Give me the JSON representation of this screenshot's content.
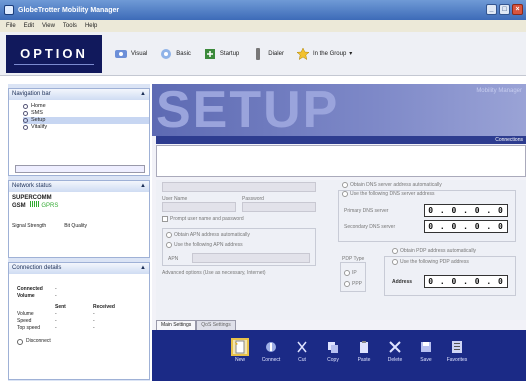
{
  "window": {
    "title": "GlobeTrotter Mobility Manager"
  },
  "menu": [
    "File",
    "Edit",
    "View",
    "Tools",
    "Help"
  ],
  "toolbar": {
    "logo": "OPTION",
    "items": [
      {
        "label": "Visual",
        "icon": "visual-icon"
      },
      {
        "label": "Basic",
        "icon": "basic-icon"
      },
      {
        "label": "Startup",
        "icon": "startup-icon"
      },
      {
        "label": "Dialer",
        "icon": "dialer-icon"
      },
      {
        "label": "In the Group",
        "icon": "star-icon"
      }
    ]
  },
  "nav_panel": {
    "title": "Navigation bar",
    "items": [
      "Home",
      "SMS",
      "Setup",
      "Vitalify"
    ],
    "selected": 2
  },
  "network_panel": {
    "title": "Network status",
    "carrier_line1": "SUPERCOMM",
    "carrier_line2": "GSM",
    "network_label": "GPRS",
    "sent_label": "Sent",
    "received_label": "Received",
    "speed_label": "Speed",
    "rows": [
      "Signal Strength",
      "Bit Quality"
    ]
  },
  "conn_panel": {
    "title": "Connection details",
    "connected_label": "Connected",
    "volume_label": "Volume",
    "col_sent": "Sent",
    "col_received": "Received",
    "row_labels": [
      "Volume",
      "Speed",
      "Top speed"
    ],
    "dash": "-",
    "disconnect_label": "Disconnect"
  },
  "setup": {
    "banner": "SETUP",
    "banner_sub": "Mobility Manager",
    "strip": "Connections",
    "username_label": "User Name",
    "password_label": "Password",
    "prompt_label": "Prompt user name and password",
    "apn_auto": "Obtain APN address automatically",
    "apn_manual": "Use the following APN address",
    "apn_label": "APN",
    "advanced_label": "Advanced options (Use as necessary, Internet)",
    "dns_auto": "Obtain DNS server address automatically",
    "dns_manual": "Use the following DNS server address",
    "primary_dns": "Primary DNS server",
    "secondary_dns": "Secondary DNS server",
    "pdp_type": "PDP Type",
    "pdp_ip": "IP",
    "pdp_ppp": "PPP",
    "pdp_auto": "Obtain PDP address automatically",
    "pdp_manual": "Use the following PDP address",
    "address_label": "Address",
    "ip_value": "0 . 0 . 0 . 0",
    "tabs": [
      "Main Settings",
      "QoS Settings"
    ]
  },
  "bottom_bar": {
    "buttons": [
      {
        "label": "New",
        "icon": "new-icon"
      },
      {
        "label": "Connect",
        "icon": "connect-icon"
      },
      {
        "label": "Cut",
        "icon": "cut-icon"
      },
      {
        "label": "Copy",
        "icon": "copy-icon"
      },
      {
        "label": "Paste",
        "icon": "paste-icon"
      },
      {
        "label": "Delete",
        "icon": "delete-icon"
      },
      {
        "label": "Save",
        "icon": "save-icon"
      },
      {
        "label": "Favorites",
        "icon": "favorites-icon"
      }
    ]
  }
}
